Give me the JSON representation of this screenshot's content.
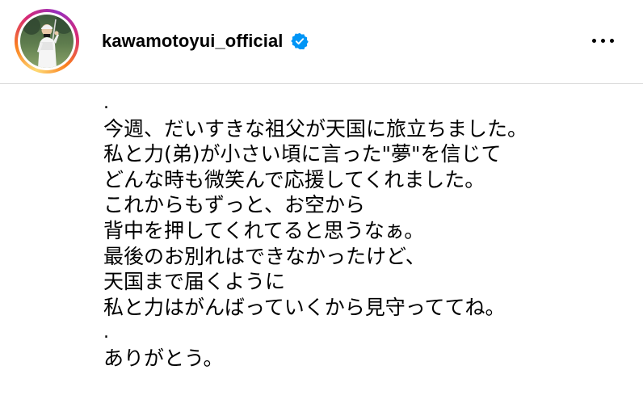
{
  "post": {
    "username": "kawamotoyui_official",
    "verified": true,
    "avatar_icon": "profile-photo-golfer",
    "more_icon": "more-options-icon",
    "caption_lines": [
      ".",
      "今週、だいすきな祖父が天国に旅立ちました。",
      "私と力(弟)が小さい頃に言った\"夢\"を信じて",
      "どんな時も微笑んで応援してくれました。",
      "これからもずっと、お空から",
      "背中を押してくれてると思うなぁ。",
      "最後のお別れはできなかったけど、",
      "天国まで届くように",
      "私と力はがんばっていくから見守っててね。",
      ".",
      "ありがとう。"
    ]
  },
  "colors": {
    "verified_badge": "#0095f6",
    "divider": "#dbdbdb",
    "text": "#000000",
    "story_ring": [
      "#feda75",
      "#fa7e1e",
      "#d62976",
      "#962fbf"
    ]
  }
}
